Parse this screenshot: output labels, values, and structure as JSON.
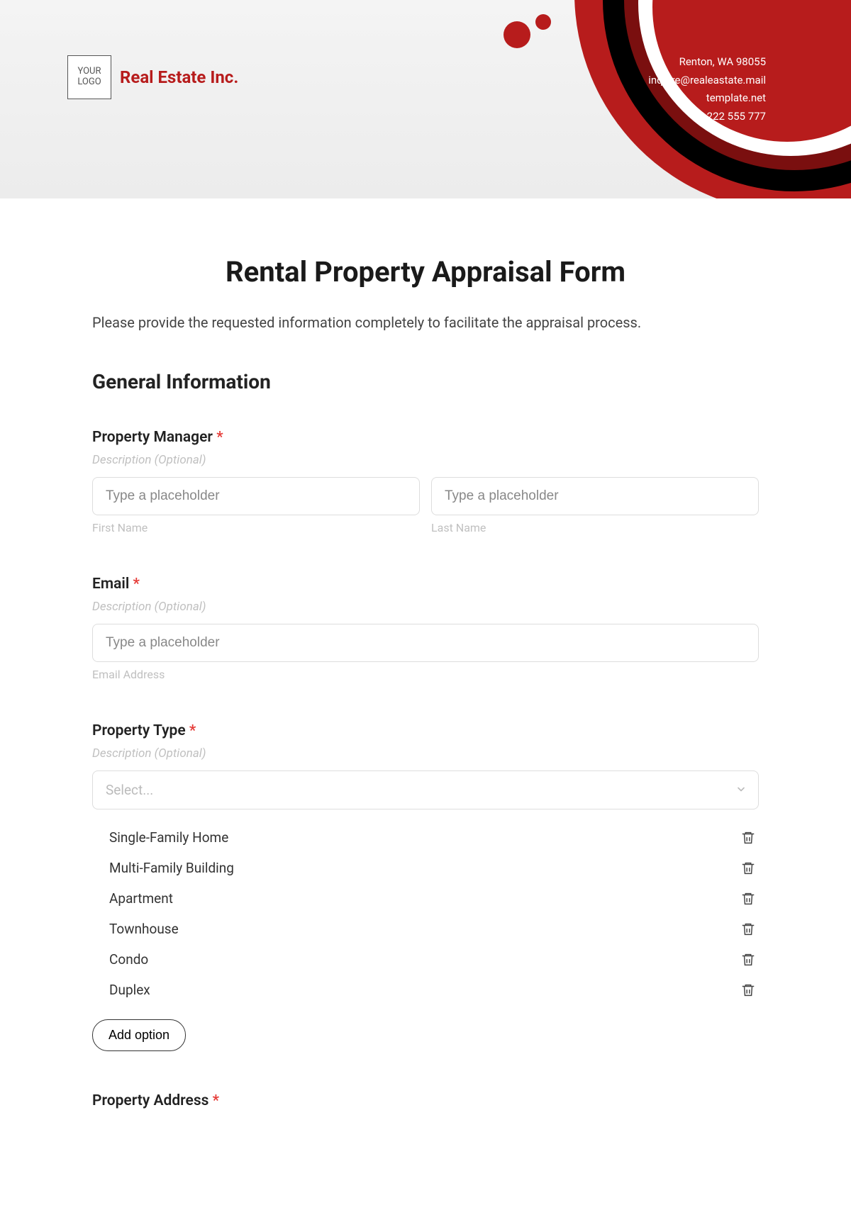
{
  "header": {
    "logo_text": "YOUR\nLOGO",
    "company_name": "Real Estate Inc.",
    "contact": {
      "line1": "Renton, WA 98055",
      "line2": "inquire@realeastate.mail",
      "line3": "template.net",
      "line4": "222 555 777"
    }
  },
  "form": {
    "title": "Rental Property Appraisal Form",
    "description": "Please provide the requested information completely to facilitate the appraisal process.",
    "section_general": "General Information",
    "desc_hint": "Description (Optional)",
    "placeholder_generic": "Type a placeholder",
    "fields": {
      "manager": {
        "label": "Property Manager",
        "first_sublabel": "First Name",
        "last_sublabel": "Last Name"
      },
      "email": {
        "label": "Email",
        "sublabel": "Email Address"
      },
      "property_type": {
        "label": "Property Type",
        "select_placeholder": "Select...",
        "options": [
          "Single-Family Home",
          "Multi-Family Building",
          "Apartment",
          "Townhouse",
          "Condo",
          "Duplex"
        ],
        "add_option": "Add option"
      },
      "property_address": {
        "label": "Property Address"
      }
    }
  }
}
